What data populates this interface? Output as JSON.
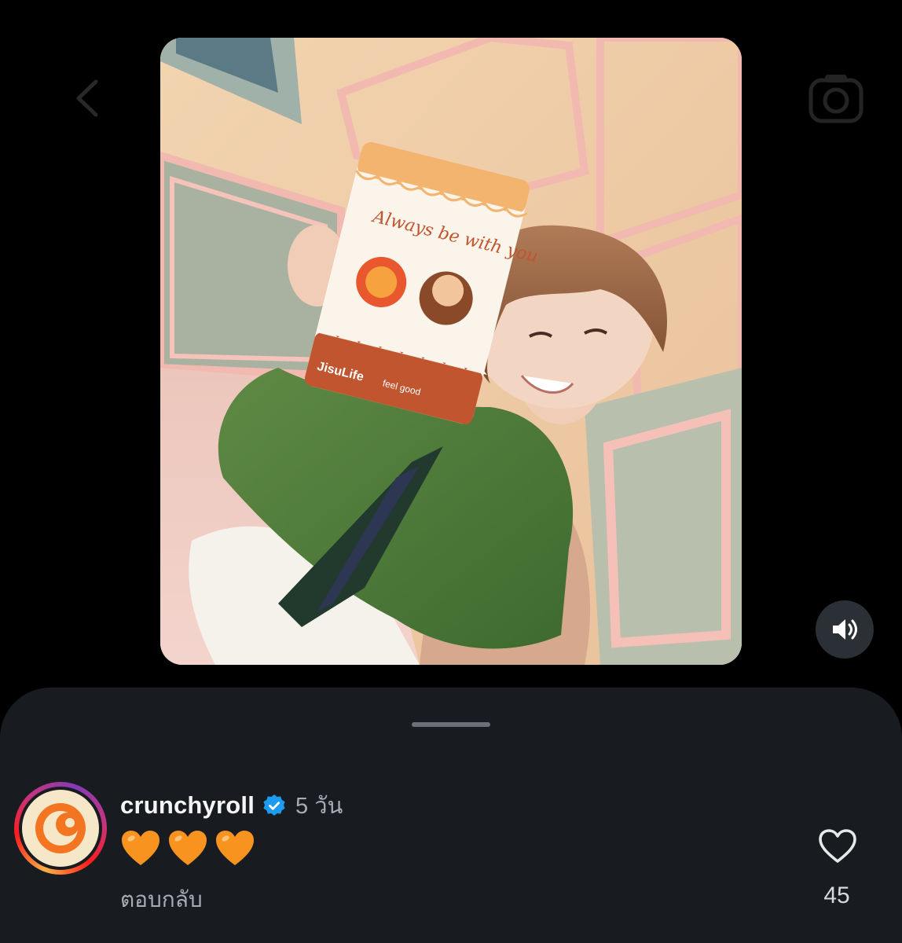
{
  "colors": {
    "background": "#000000",
    "sheet": "#181b1f",
    "verified_blue": "#1d9bf0",
    "heart_orange": "#f7931e",
    "crunchyroll_orange": "#f47521"
  },
  "photo": {
    "box_brand": "JisuLife",
    "box_slogan": "feel good",
    "box_script": "Always be with you"
  },
  "controls": {
    "sound_icon": "speaker-icon",
    "back_icon": "chevron-left-icon",
    "camera_icon": "camera-icon"
  },
  "comment": {
    "username": "crunchyroll",
    "verified": true,
    "time": "5 วัน",
    "text_emojis": [
      "orange-heart",
      "orange-heart",
      "orange-heart"
    ],
    "reply_label": "ตอบกลับ",
    "like_count": "45"
  }
}
